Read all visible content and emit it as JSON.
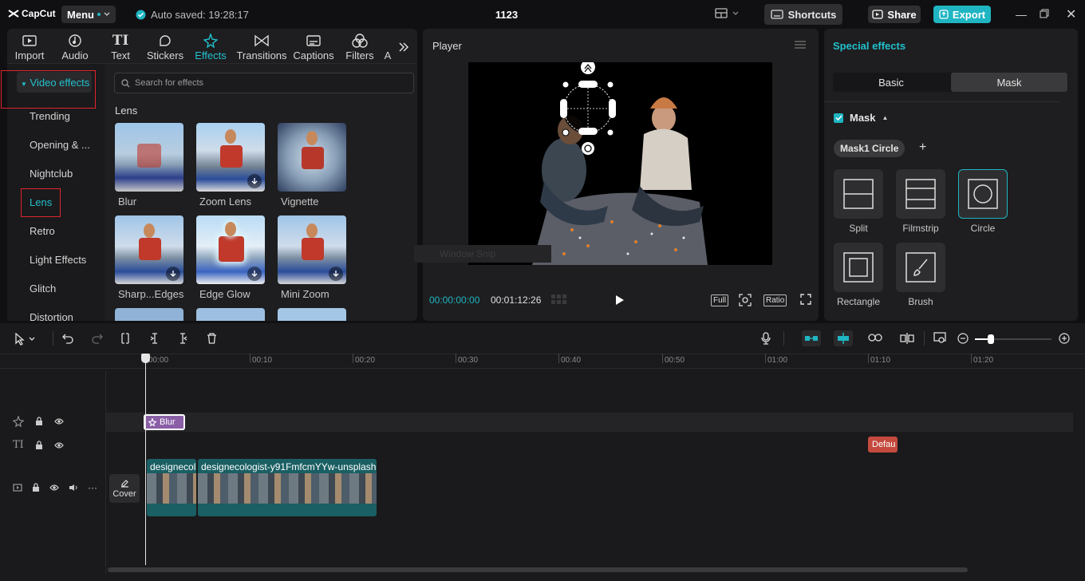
{
  "app": {
    "logo": "CapCut",
    "menu_label": "Menu",
    "autosave": "Auto saved: 19:28:17",
    "project_title": "1123",
    "shortcuts": "Shortcuts",
    "share": "Share",
    "export": "Export",
    "accent_color": "#1fb5c2"
  },
  "left_tabs": [
    "Import",
    "Audio",
    "Text",
    "Stickers",
    "Effects",
    "Transitions",
    "Captions",
    "Filters",
    "A"
  ],
  "left_tabs_active": "Effects",
  "sidebar": {
    "header": "Video effects",
    "items": [
      "Trending",
      "Opening & ...",
      "Nightclub",
      "Lens",
      "Retro",
      "Light Effects",
      "Glitch",
      "Distortion"
    ],
    "active": "Lens"
  },
  "effects": {
    "search_placeholder": "Search for effects",
    "section": "Lens",
    "items": [
      "Blur",
      "Zoom Lens",
      "Vignette",
      "Sharp...Edges",
      "Edge Glow",
      "Mini Zoom"
    ]
  },
  "player": {
    "title": "Player",
    "current_time": "00:00:00:00",
    "total_time": "00:01:12:26",
    "full": "Full",
    "ratio": "Ratio",
    "ghost_text": "Window Snip"
  },
  "special_effects": {
    "title": "Special effects",
    "tabs": [
      "Basic",
      "Mask"
    ],
    "active_tab": "Mask",
    "mask_label": "Mask",
    "mask_checked": true,
    "mask_chip": "Mask1 Circle",
    "masks": [
      "Split",
      "Filmstrip",
      "Circle",
      "Rectangle",
      "Brush"
    ],
    "selected_mask": "Circle"
  },
  "timeline": {
    "ruler": [
      "00:00",
      "00:10",
      "00:20",
      "00:30",
      "00:40",
      "00:50",
      "01:00",
      "01:10",
      "01:20"
    ],
    "effect_clip": "Blur",
    "default_clip": "Defau",
    "clip1": "designecol",
    "clip2": "designecologist-y91FmfcmYYw-unsplash",
    "cover": "Cover"
  }
}
